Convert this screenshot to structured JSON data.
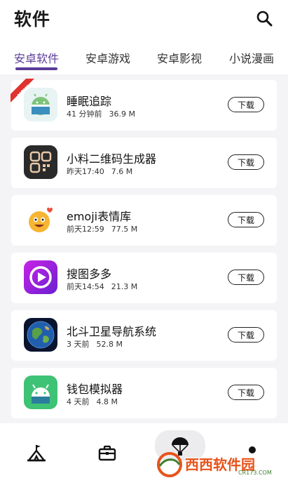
{
  "header": {
    "title": "软件"
  },
  "tabs": [
    {
      "label": "安卓软件",
      "active": true
    },
    {
      "label": "安卓游戏",
      "active": false
    },
    {
      "label": "安卓影视",
      "active": false
    },
    {
      "label": "小说漫画",
      "active": false
    }
  ],
  "apps": [
    {
      "name": "睡眠追踪",
      "time": "41 分钟前",
      "size": "36.9 M",
      "button": "下载",
      "badge": "NEW",
      "icon": "sleep-tracker-icon"
    },
    {
      "name": "小料二维码生成器",
      "time": "昨天17:40",
      "size": "7.6 M",
      "button": "下载",
      "icon": "qr-code-icon"
    },
    {
      "name": "emoji表情库",
      "time": "前天12:59",
      "size": "77.5 M",
      "button": "下载",
      "icon": "emoji-face-icon"
    },
    {
      "name": "搜图多多",
      "time": "前天14:54",
      "size": "21.3 M",
      "button": "下载",
      "icon": "play-video-icon"
    },
    {
      "name": "北斗卫星导航系统",
      "time": "3 天前",
      "size": "52.8 M",
      "button": "下载",
      "icon": "earth-globe-icon"
    },
    {
      "name": "钱包模拟器",
      "time": "4 天前",
      "size": "4.8 M",
      "button": "下载",
      "icon": "android-robot-icon"
    }
  ],
  "watermark": {
    "text": "西西软件园",
    "sub": "CR173.COM"
  },
  "colors": {
    "accent": "#5b3b9a",
    "watermark": "#e8531a"
  }
}
